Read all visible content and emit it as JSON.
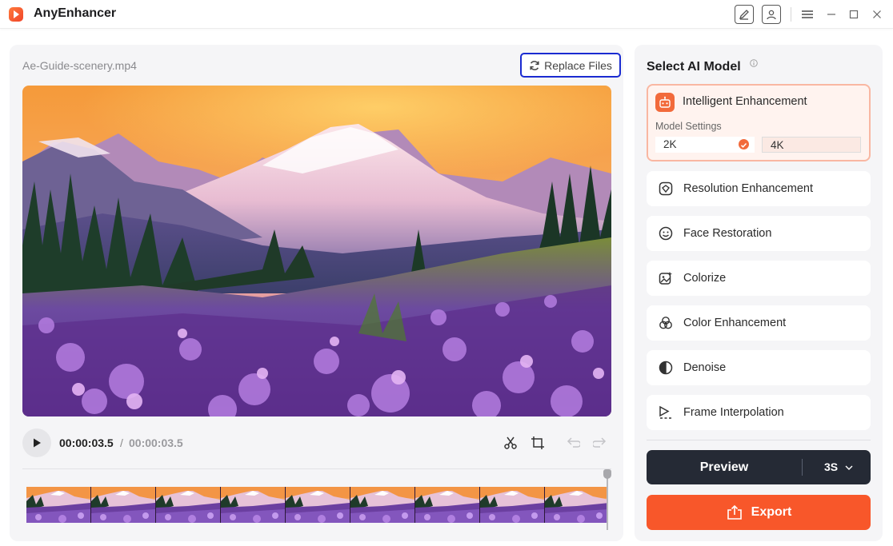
{
  "app": {
    "title": "AnyEnhancer"
  },
  "titlebar": {
    "icons": [
      "feedback-edit-icon",
      "account-icon",
      "menu-icon",
      "minimize-icon",
      "maximize-icon",
      "close-icon"
    ]
  },
  "editor": {
    "file_name": "Ae-Guide-scenery.mp4",
    "replace_label": "Replace Files",
    "time_current": "00:00:03.5",
    "time_separator": "/",
    "time_total": "00:00:03.5",
    "control_icons": [
      "cut-icon",
      "crop-icon",
      "undo-icon",
      "redo-icon"
    ],
    "timeline_frames": 9
  },
  "sidebar": {
    "title": "Select AI Model",
    "selected_model": {
      "label": "Intelligent Enhancement",
      "icon": "robot-icon",
      "settings_label": "Model Settings",
      "options": [
        "2K",
        "4K"
      ],
      "selected_option": "2K"
    },
    "models": [
      {
        "label": "Resolution Enhancement",
        "icon": "resolution-icon"
      },
      {
        "label": "Face Restoration",
        "icon": "face-icon"
      },
      {
        "label": "Colorize",
        "icon": "colorize-icon"
      },
      {
        "label": "Color Enhancement",
        "icon": "color-circles-icon"
      },
      {
        "label": "Denoise",
        "icon": "denoise-icon"
      },
      {
        "label": "Frame Interpolation",
        "icon": "frame-interpolation-icon"
      }
    ],
    "preview_label": "Preview",
    "preview_duration": "3S",
    "export_label": "Export"
  },
  "colors": {
    "accent": "#f8572a",
    "dark_button": "#252a35",
    "highlight_border": "#1a2bd1"
  }
}
